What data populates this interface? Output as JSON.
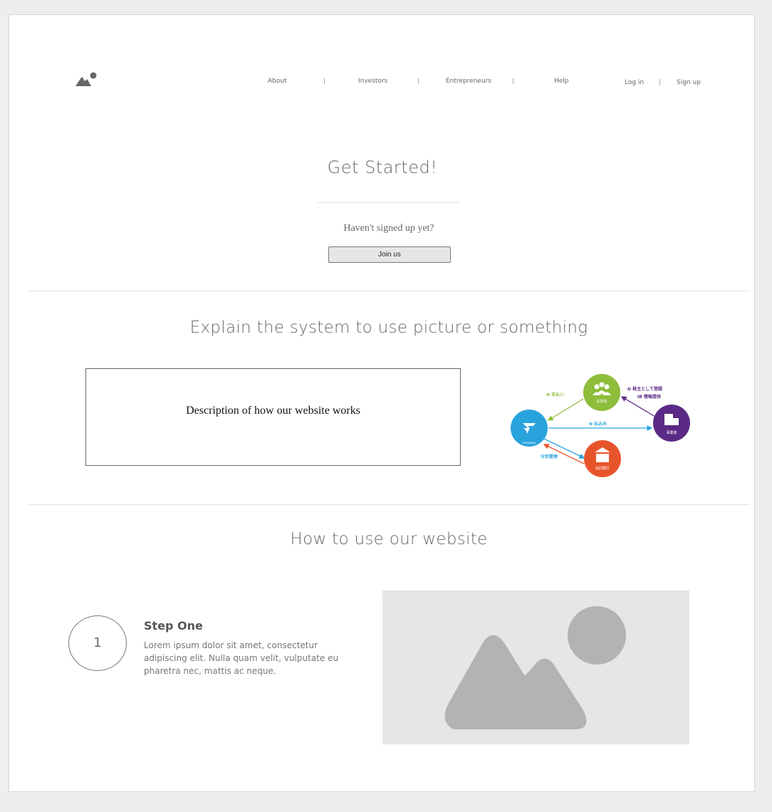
{
  "nav": {
    "items": [
      {
        "label": "About"
      },
      {
        "label": "Investors"
      },
      {
        "label": "Entrepreneurs"
      },
      {
        "label": "Help"
      }
    ],
    "auth": {
      "login": "Log in",
      "signup": "Sign up"
    }
  },
  "hero": {
    "title": "Get Started!",
    "subtitle": "Haven't signed up yet?",
    "button": "Join us"
  },
  "explain": {
    "title": "Explain the system to use picture or something",
    "description": "Description of how our website works",
    "diagram": {
      "center_label": "FUNDINNO",
      "investor_label": "投資家",
      "company_label": "事業者",
      "bank_label": "信託銀行",
      "step1": "❶ 支払い",
      "step2": "❷ 払込み",
      "step3a": "❸ 株主として登録",
      "step3b": "IR 情報提供",
      "separate": "分別管理",
      "colors": {
        "green": "#8dbd3a",
        "blue": "#29a3dc",
        "purple": "#5b2a86",
        "orange": "#e8542a"
      }
    }
  },
  "howto": {
    "title": "How to use our website",
    "step": {
      "number": "1",
      "title": "Step One",
      "text": "Lorem ipsum dolor sit amet, consectetur adipiscing elit. Nulla quam velit, vulputate eu pharetra nec, mattis ac neque."
    }
  }
}
